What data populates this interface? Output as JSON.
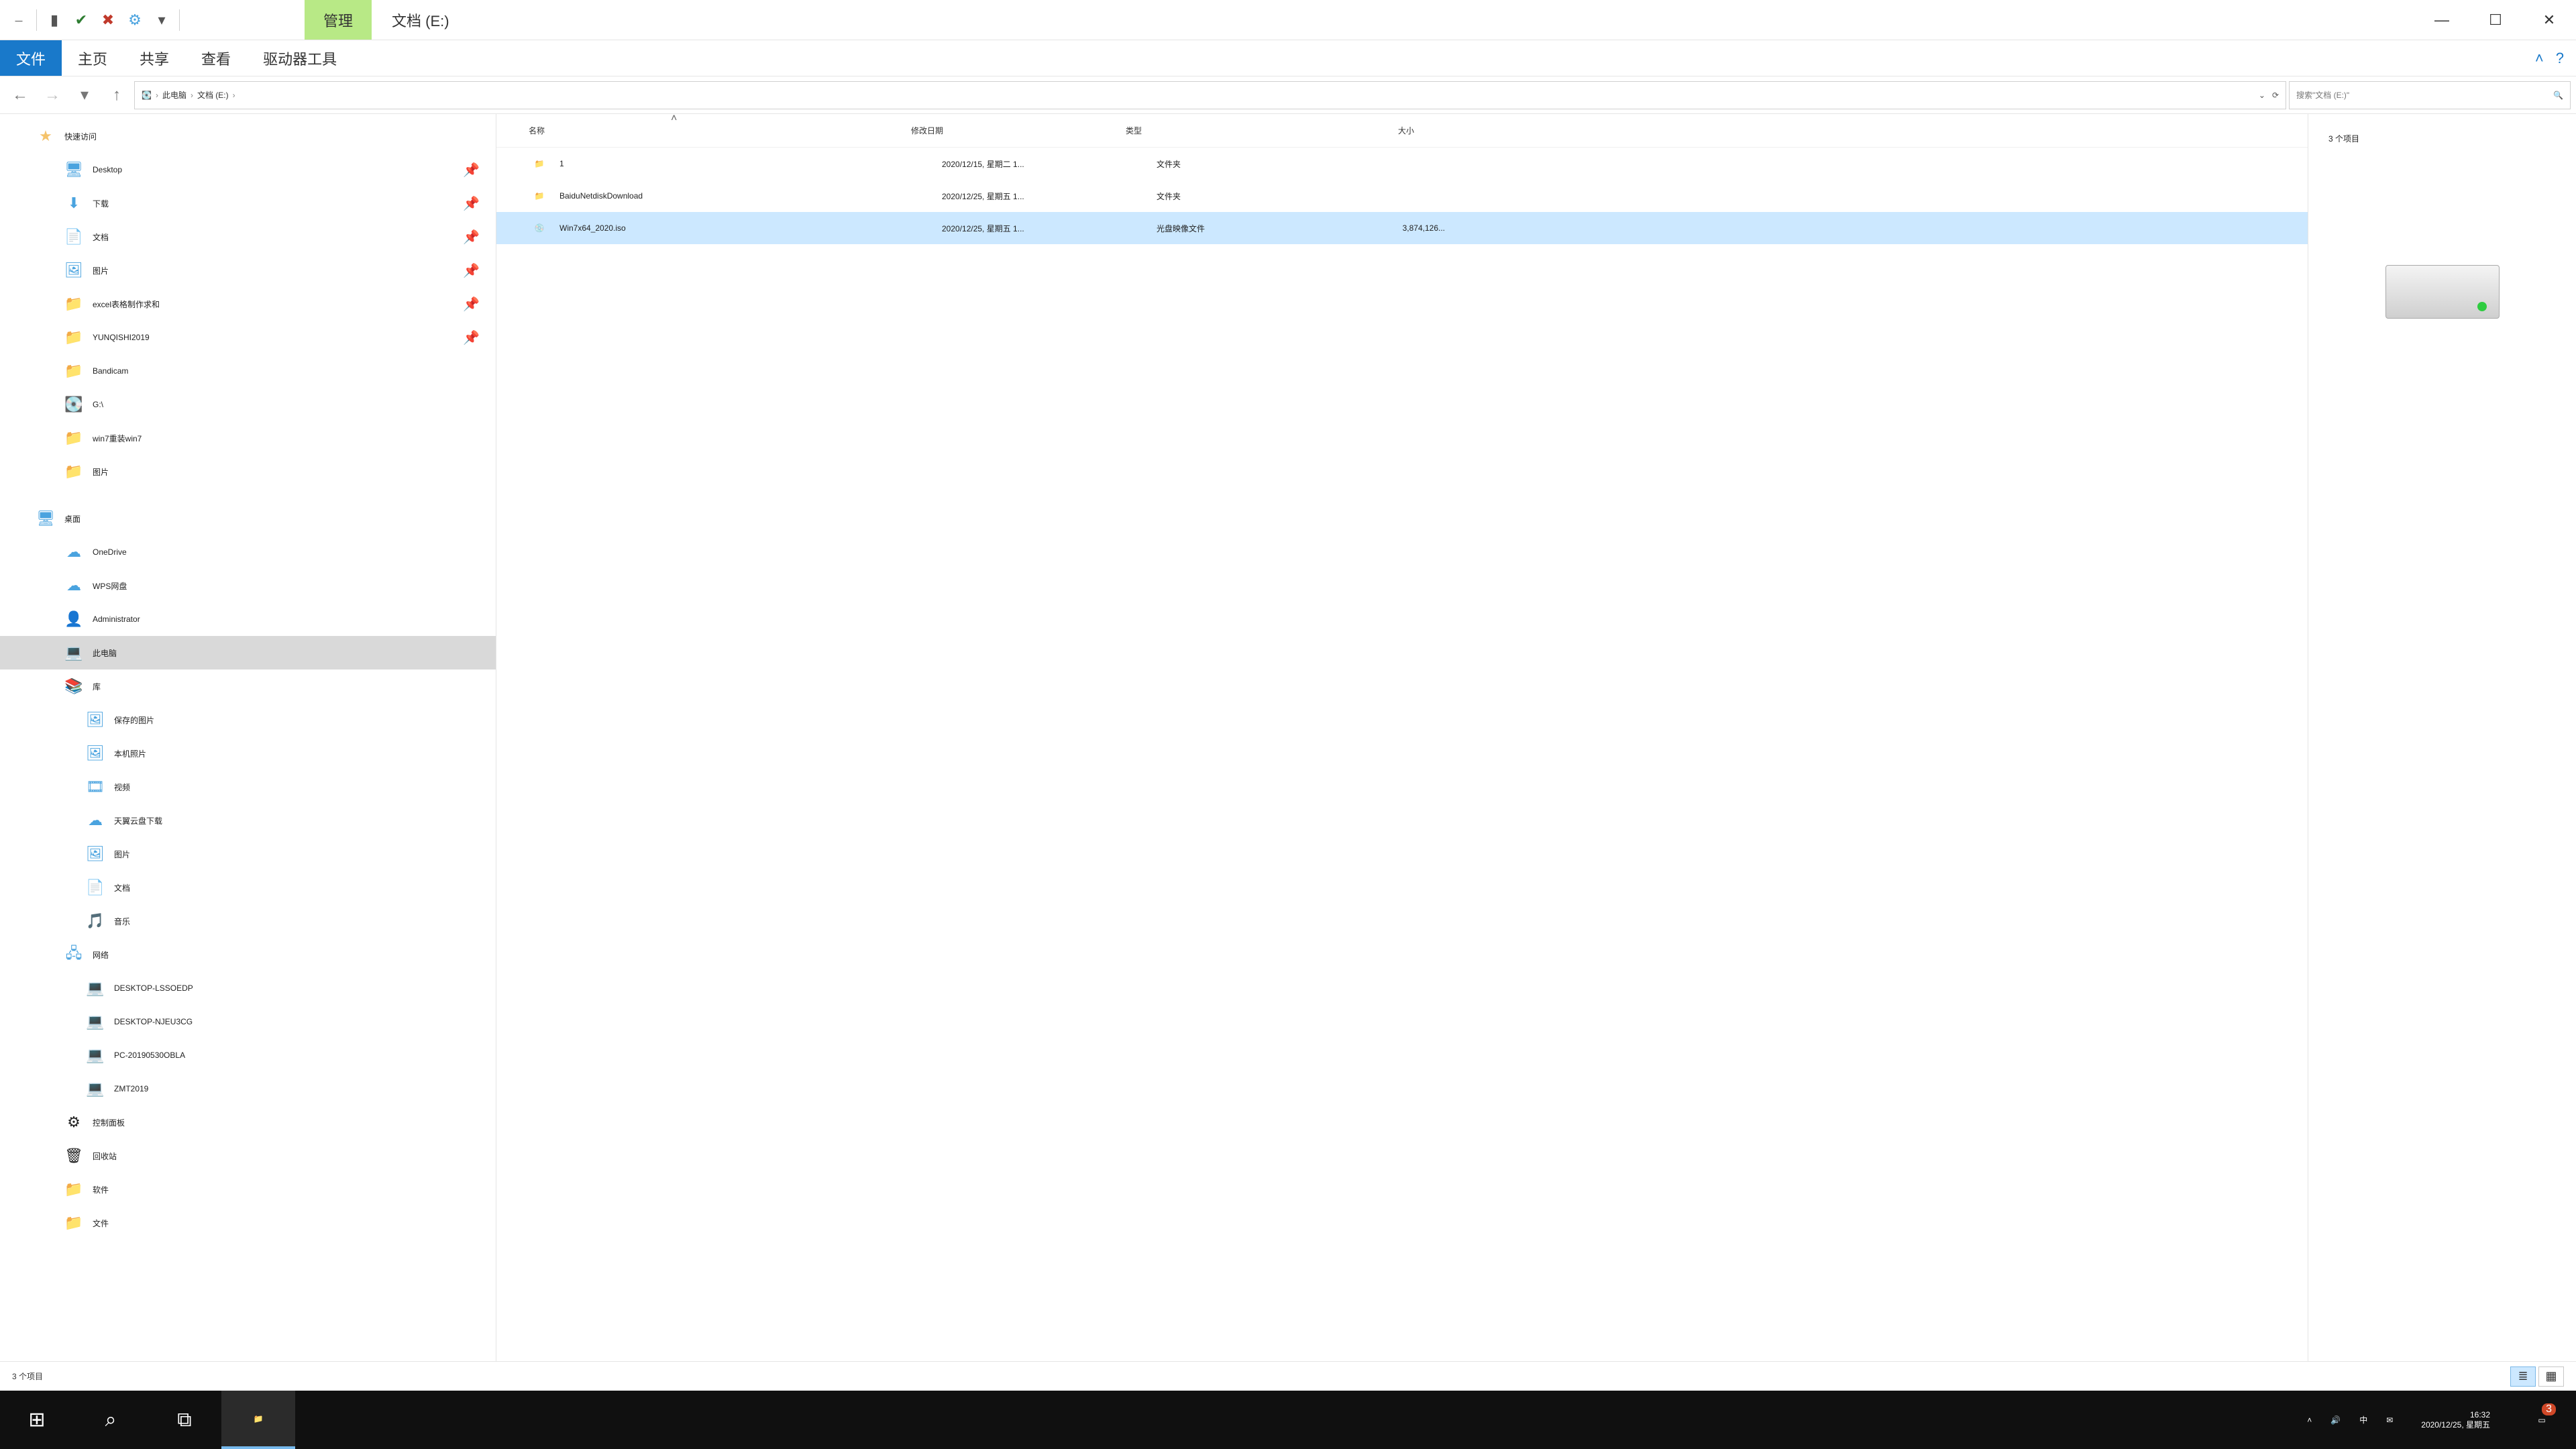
{
  "titlebar": {
    "context_tab": "管理",
    "window_title": "文档 (E:)"
  },
  "ribbon": {
    "file": "文件",
    "tabs": [
      "主页",
      "共享",
      "查看",
      "驱动器工具"
    ]
  },
  "nav": {
    "breadcrumb": [
      "此电脑",
      "文档 (E:)"
    ],
    "search_placeholder": "搜索\"文档 (E:)\""
  },
  "tree": {
    "quick_access": "快速访问",
    "quick_items": [
      {
        "label": "Desktop",
        "icon": "🖥",
        "tint": "ic-blue",
        "pin": true
      },
      {
        "label": "下载",
        "icon": "⬇",
        "tint": "ic-blue",
        "pin": true
      },
      {
        "label": "文档",
        "icon": "📄",
        "tint": "ic-folder",
        "pin": true
      },
      {
        "label": "图片",
        "icon": "🖼",
        "tint": "ic-blue",
        "pin": true
      },
      {
        "label": "excel表格制作求和",
        "icon": "📁",
        "tint": "ic-folder",
        "pin": true
      },
      {
        "label": "YUNQISHI2019",
        "icon": "📁",
        "tint": "ic-folder",
        "pin": true
      },
      {
        "label": "Bandicam",
        "icon": "📁",
        "tint": "ic-folder",
        "pin": false
      },
      {
        "label": "G:\\",
        "icon": "💽",
        "tint": "ic-blue",
        "pin": false
      },
      {
        "label": "win7重装win7",
        "icon": "📁",
        "tint": "ic-folder",
        "pin": false
      },
      {
        "label": "图片",
        "icon": "📁",
        "tint": "ic-folder",
        "pin": false
      }
    ],
    "desktop": "桌面",
    "desktop_items": [
      {
        "label": "OneDrive",
        "icon": "☁",
        "tint": "ic-blue"
      },
      {
        "label": "WPS网盘",
        "icon": "☁",
        "tint": "ic-blue"
      },
      {
        "label": "Administrator",
        "icon": "👤",
        "tint": ""
      },
      {
        "label": "此电脑",
        "icon": "💻",
        "tint": "ic-pc",
        "selected": true
      },
      {
        "label": "库",
        "icon": "📚",
        "tint": "ic-folder"
      }
    ],
    "library_items": [
      {
        "label": "保存的图片",
        "icon": "🖼",
        "tint": "ic-blue"
      },
      {
        "label": "本机照片",
        "icon": "🖼",
        "tint": "ic-blue"
      },
      {
        "label": "视频",
        "icon": "🎞",
        "tint": "ic-blue"
      },
      {
        "label": "天翼云盘下载",
        "icon": "☁",
        "tint": "ic-blue"
      },
      {
        "label": "图片",
        "icon": "🖼",
        "tint": "ic-blue"
      },
      {
        "label": "文档",
        "icon": "📄",
        "tint": "ic-folder"
      },
      {
        "label": "音乐",
        "icon": "🎵",
        "tint": "ic-blue"
      }
    ],
    "network": "网络",
    "network_items": [
      {
        "label": "DESKTOP-LSSOEDP",
        "icon": "💻",
        "tint": "ic-pc"
      },
      {
        "label": "DESKTOP-NJEU3CG",
        "icon": "💻",
        "tint": "ic-pc"
      },
      {
        "label": "PC-20190530OBLA",
        "icon": "💻",
        "tint": "ic-pc"
      },
      {
        "label": "ZMT2019",
        "icon": "💻",
        "tint": "ic-pc"
      }
    ],
    "extras": [
      {
        "label": "控制面板",
        "icon": "⚙",
        "tint": ""
      },
      {
        "label": "回收站",
        "icon": "🗑",
        "tint": ""
      },
      {
        "label": "软件",
        "icon": "📁",
        "tint": "ic-folder"
      },
      {
        "label": "文件",
        "icon": "📁",
        "tint": "ic-folder"
      }
    ]
  },
  "columns": {
    "name": "名称",
    "date": "修改日期",
    "type": "类型",
    "size": "大小"
  },
  "files": [
    {
      "name": "1",
      "date": "2020/12/15, 星期二 1...",
      "type": "文件夹",
      "size": "",
      "icon": "📁",
      "tint": "ic-folder"
    },
    {
      "name": "BaiduNetdiskDownload",
      "date": "2020/12/25, 星期五 1...",
      "type": "文件夹",
      "size": "",
      "icon": "📁",
      "tint": "ic-folder"
    },
    {
      "name": "Win7x64_2020.iso",
      "date": "2020/12/25, 星期五 1...",
      "type": "光盘映像文件",
      "size": "3,874,126...",
      "icon": "💿",
      "tint": "ic-disc",
      "selected": true
    }
  ],
  "preview": {
    "count_text": "3 个项目"
  },
  "status": {
    "text": "3 个项目"
  },
  "taskbar": {
    "time": "16:32",
    "date": "2020/12/25, 星期五",
    "ime": "中",
    "notif_count": "3"
  }
}
